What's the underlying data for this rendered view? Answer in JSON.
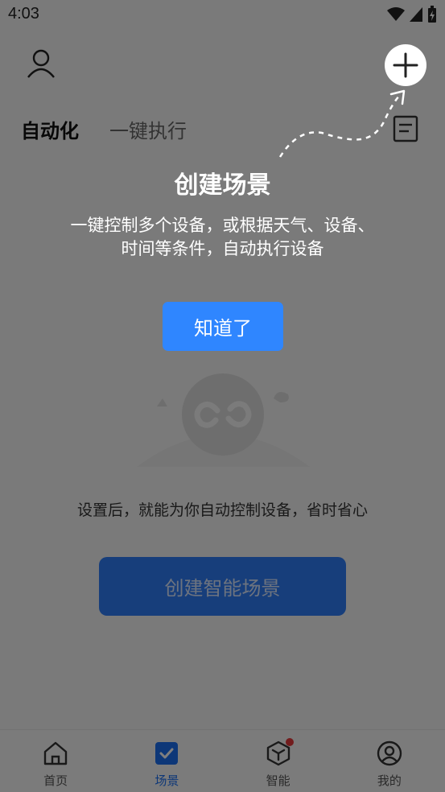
{
  "status_bar": {
    "time": "4:03"
  },
  "header": {
    "tabs": [
      {
        "label": "自动化"
      },
      {
        "label": "一键执行"
      }
    ]
  },
  "main": {
    "empty_text": "设置后，就能为你自动控制设备，省时省心",
    "create_button_label": "创建智能场景"
  },
  "bottom_nav": {
    "items": [
      {
        "label": "首页",
        "icon": "home-icon"
      },
      {
        "label": "场景",
        "icon": "scene-check-icon"
      },
      {
        "label": "智能",
        "icon": "smart-cube-icon"
      },
      {
        "label": "我的",
        "icon": "user-circle-icon"
      }
    ]
  },
  "guide": {
    "title": "创建场景",
    "description": "一键控制多个设备，或根据天气、设备、时间等条件，自动执行设备",
    "ok_label": "知道了"
  },
  "colors": {
    "accent": "#2f86ff",
    "badge": "#e5393a",
    "overlay": "rgba(0,0,0,0.5)"
  }
}
